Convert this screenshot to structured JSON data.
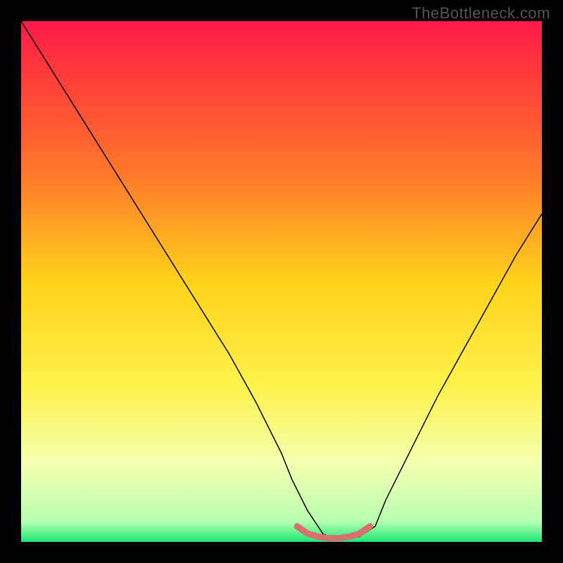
{
  "watermark": "TheBottleneck.com",
  "chart_data": {
    "type": "line",
    "title": "",
    "xlabel": "",
    "ylabel": "",
    "xlim": [
      0,
      100
    ],
    "ylim": [
      0,
      100
    ],
    "background_gradient": {
      "stops": [
        {
          "offset": 0.0,
          "color": "#ff1a4b"
        },
        {
          "offset": 0.1,
          "color": "#ff3a3a"
        },
        {
          "offset": 0.3,
          "color": "#ff7a2a"
        },
        {
          "offset": 0.5,
          "color": "#ffd21a"
        },
        {
          "offset": 0.7,
          "color": "#fff24a"
        },
        {
          "offset": 0.85,
          "color": "#f4ffb0"
        },
        {
          "offset": 0.96,
          "color": "#b8ffb0"
        },
        {
          "offset": 1.0,
          "color": "#1ee776"
        }
      ]
    },
    "series": [
      {
        "name": "bottleneck-curve",
        "color": "#000000",
        "width": 1.5,
        "x": [
          0,
          5,
          10,
          15,
          20,
          25,
          30,
          35,
          40,
          45,
          50,
          52,
          55,
          58,
          60,
          62,
          65,
          68,
          70,
          75,
          80,
          85,
          90,
          95,
          100
        ],
        "y": [
          100,
          92,
          84,
          76,
          68,
          60,
          52,
          44,
          36,
          27,
          17,
          12,
          6,
          1.5,
          0.8,
          0.6,
          1.0,
          3,
          8,
          18,
          28,
          37,
          46,
          55,
          63
        ]
      },
      {
        "name": "optimal-zone",
        "color": "#d96f6f",
        "width": 9,
        "x": [
          53,
          55,
          57,
          59,
          61,
          63,
          65,
          67
        ],
        "y": [
          3.0,
          1.6,
          1.0,
          0.7,
          0.7,
          1.0,
          1.6,
          3.0
        ]
      }
    ]
  }
}
